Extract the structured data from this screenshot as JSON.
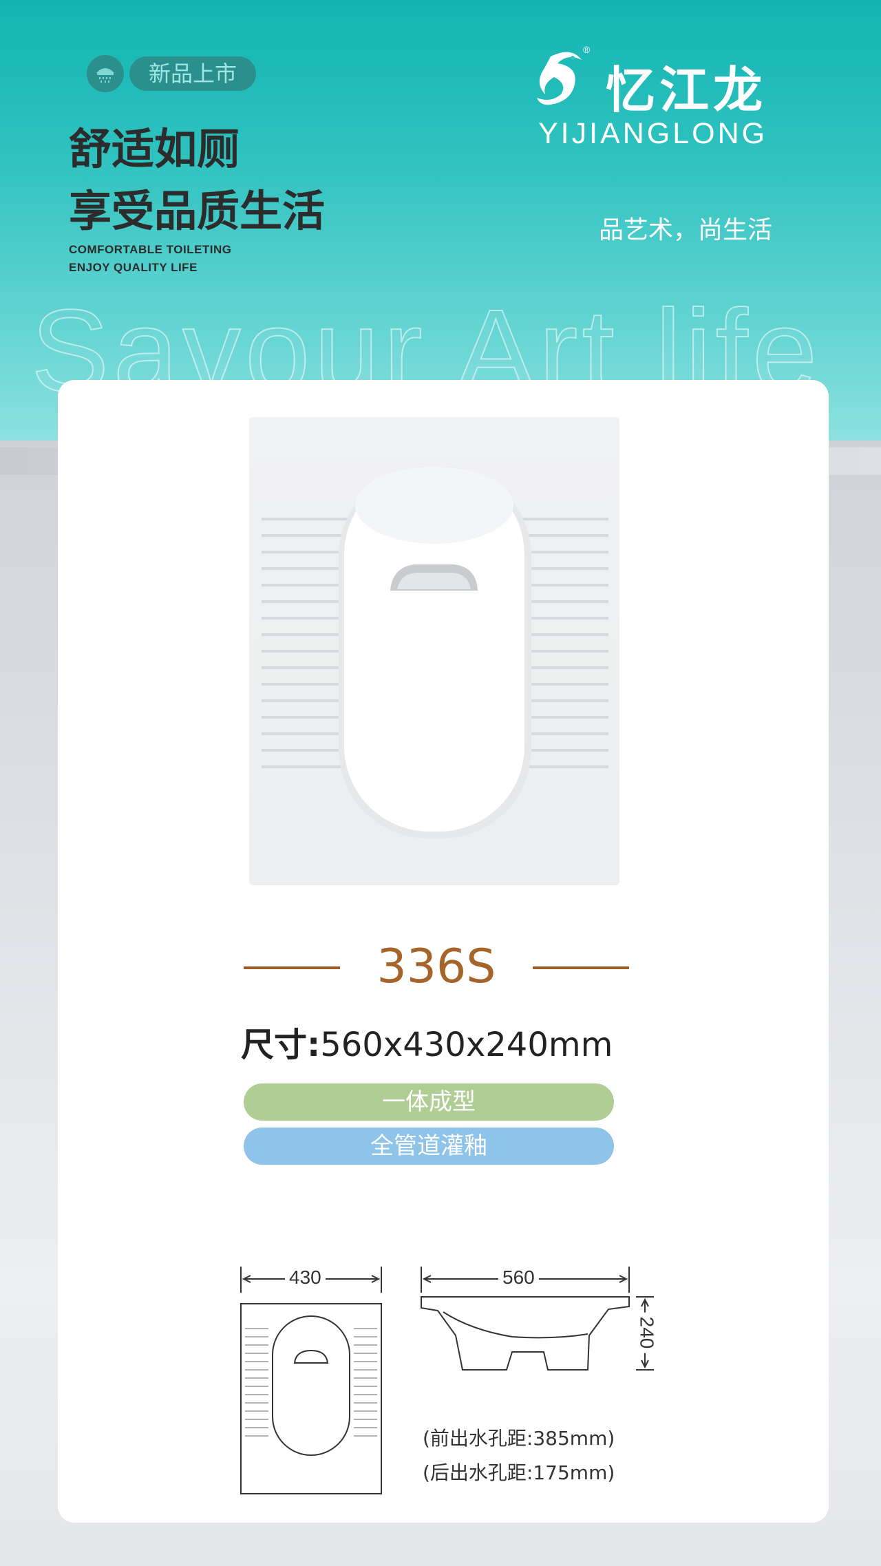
{
  "badge": {
    "label": "新品上市",
    "icon": "shower-icon"
  },
  "headline": {
    "line1": "舒适如厕",
    "line2": "享受品质生活"
  },
  "subtitle_en": {
    "line1": "COMFORTABLE TOILETING",
    "line2": "ENJOY QUALITY LIFE"
  },
  "brand": {
    "name_cn": "忆江龙",
    "name_en": "YIJIANGLONG",
    "registered": "®"
  },
  "slogan": "品艺术，尚生活",
  "watermark": "Savour Art life",
  "product": {
    "model": "336S",
    "size_label": "尺寸:",
    "size_value": "560x430x240mm",
    "features": [
      "一体成型",
      "全管道灌釉"
    ]
  },
  "dimensions": {
    "width": "430",
    "length": "560",
    "height": "240",
    "front_outlet": "(前出水孔距:385mm)",
    "rear_outlet": "(后出水孔距:175mm)"
  },
  "colors": {
    "teal": "#12b4b1",
    "model_brown": "#a5652a",
    "tag_green": "#b1cd96",
    "tag_blue": "#8ec3ea"
  }
}
